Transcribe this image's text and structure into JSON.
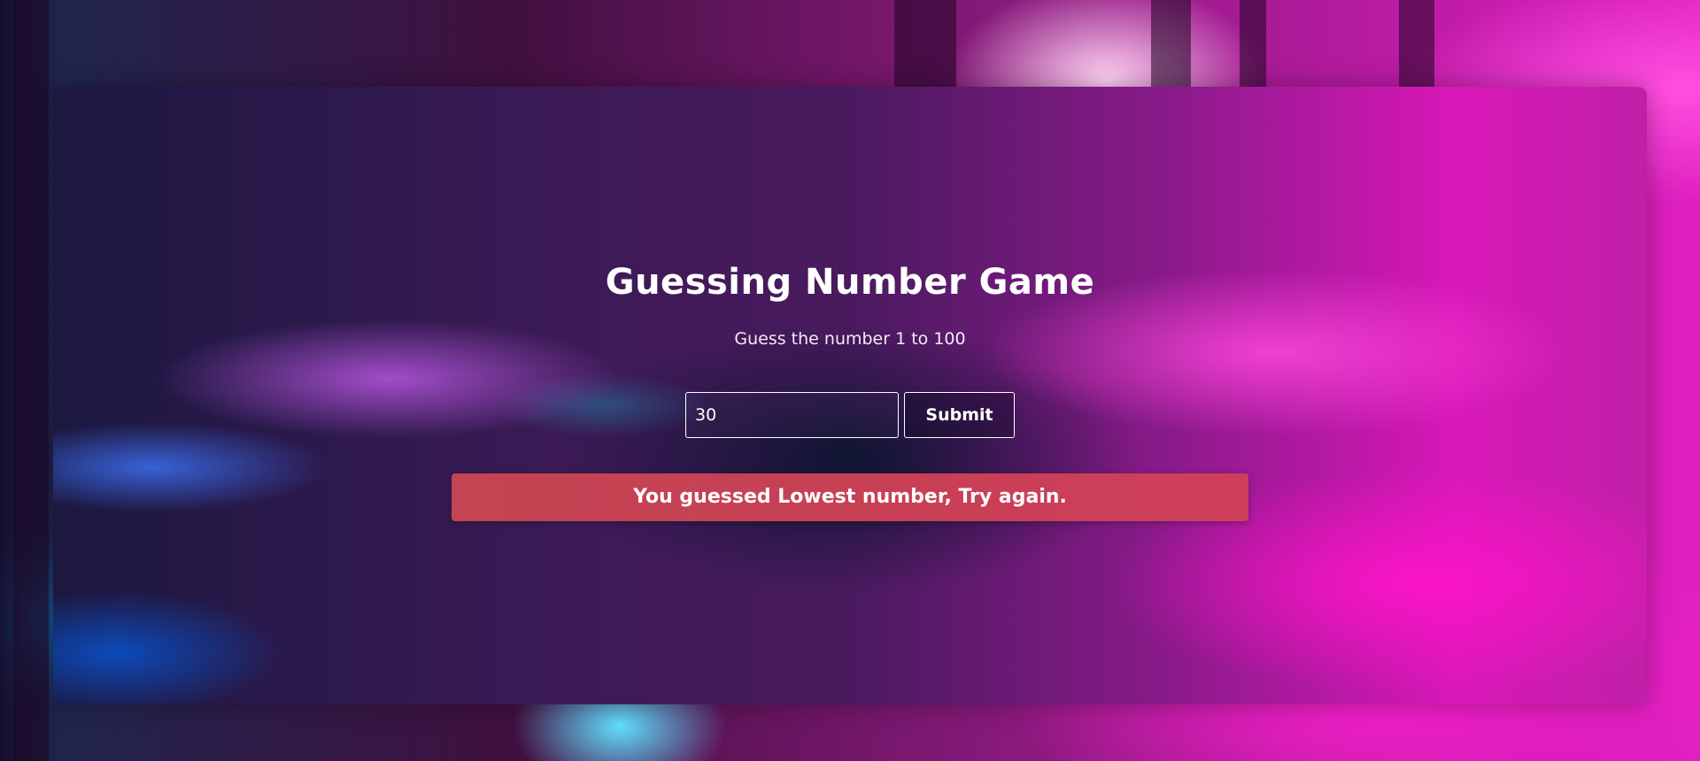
{
  "game": {
    "title": "Guessing Number Game",
    "instruction": "Guess the number 1 to 100",
    "guess_value": "30",
    "submit_label": "Submit",
    "result_message": "You guessed Lowest number, Try again."
  },
  "colors": {
    "result_banner": "#c8424f",
    "text": "#ffffff",
    "accent_magenta": "#e020c0",
    "accent_blue": "#1c2850"
  }
}
